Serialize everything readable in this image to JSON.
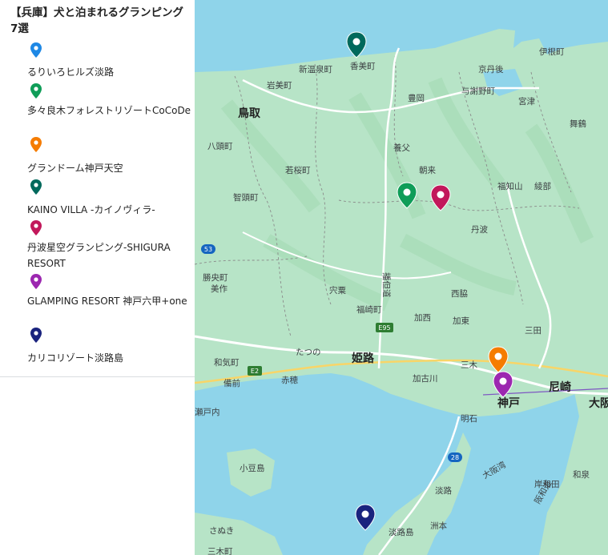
{
  "sidebar": {
    "title": "【兵庫】犬と泊まれるグランピング7選",
    "items": [
      {
        "label": "るりいろヒルズ淡路",
        "color": "#1e88e5",
        "icon": "map-pin-icon"
      },
      {
        "label": "多々良木フォレストリゾートCoCoDe",
        "color": "#0f9d58",
        "icon": "map-pin-icon"
      },
      {
        "label": "グランドーム神戸天空",
        "color": "#f57c00",
        "icon": "map-pin-icon"
      },
      {
        "label": "KAINO VILLA -カイノヴィラ-",
        "color": "#00695c",
        "icon": "map-pin-icon"
      },
      {
        "label": "丹波星空グランピング-SHIGURA RESORT",
        "color": "#c2185b",
        "icon": "map-pin-icon"
      },
      {
        "label": "GLAMPING RESORT 神戸六甲+one",
        "color": "#9c27b0",
        "icon": "map-pin-icon"
      },
      {
        "label": "カリコリゾート淡路島",
        "color": "#1a237e",
        "icon": "map-pin-icon"
      }
    ]
  },
  "map": {
    "colors": {
      "water": "#8fd4ea",
      "land": "#b7e4c7",
      "land_dark": "#a3d9b1",
      "road": "#ffffff",
      "highway": "#f8d568",
      "border": "#8a8a8a"
    },
    "places": {
      "iwami": "岩美町",
      "shinonsen": "新温泉町",
      "kami": "香美町",
      "tottori": "鳥取",
      "toyooka": "豊岡",
      "kyotango": "京丹後",
      "yosano": "与謝野町",
      "miyazu": "宮津",
      "ine": "伊根町",
      "maizuru": "舞鶴",
      "yazu": "八頭町",
      "wakasa": "若桜町",
      "yabu": "養父",
      "asago": "朝来",
      "fukuchiyama": "福知山",
      "ayabe": "綾部",
      "chizu": "智頭町",
      "tamba": "丹波",
      "shiso": "宍粟",
      "nishiwaki": "西脇",
      "shoou": "勝央町",
      "mimasaka": "美作",
      "fukusaki": "福崎町",
      "kasai": "加西",
      "kato": "加東",
      "sanda": "三田",
      "tatsuno": "たつの",
      "himeji": "姫路",
      "miki": "三木",
      "wake": "和気町",
      "bizen": "備前",
      "ako": "赤穂",
      "kakogawa": "加古川",
      "kobe": "神戸",
      "amagasaki": "尼崎",
      "osaka": "大阪",
      "setouchi": "瀬戸内",
      "akashi": "明石",
      "shodoshima": "小豆島",
      "awaji": "淡路",
      "awajishima": "淡路島",
      "sumoto": "洲本",
      "sanuki": "さぬき",
      "miki2": "三木町",
      "kishiwada": "岸和田",
      "izumi": "和泉",
      "osaka_bay": "大阪湾",
      "highway_harima": "播但道",
      "hanwa": "阪和道",
      "route_e95": "E95",
      "route_e2": "E2",
      "route_53": "53",
      "route_28": "28"
    }
  }
}
